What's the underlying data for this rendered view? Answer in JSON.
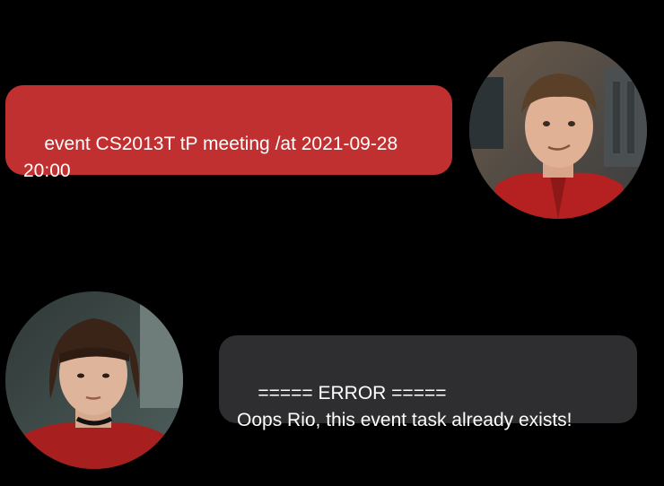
{
  "messages": [
    {
      "role": "user",
      "avatar": "user-avatar",
      "text": "event CS2013T tP meeting /at 2021-09-28\n20:00",
      "bubble_color": "#c03030"
    },
    {
      "role": "bot",
      "avatar": "bot-avatar",
      "text": "===== ERROR =====\nOops Rio, this event task already exists!",
      "bubble_color": "#2e2e30"
    }
  ],
  "colors": {
    "background": "#000000",
    "text": "#ffffff"
  }
}
